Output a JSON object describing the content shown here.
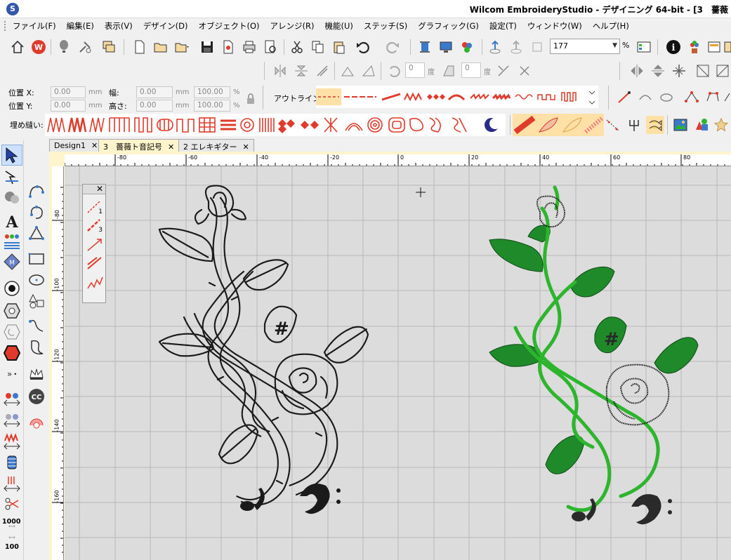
{
  "window": {
    "title": "Wilcom EmbroideryStudio - デザイニング 64-bit - [3　薔薇"
  },
  "menu": {
    "items": [
      "ファイル(F)",
      "編集(E)",
      "表示(V)",
      "デザイン(D)",
      "オブジェクト(O)",
      "アレンジ(R)",
      "機能(U)",
      "ステッチ(S)",
      "グラフィック(G)",
      "設定(T)",
      "ウィンドウ(W)",
      "ヘルプ(H)"
    ]
  },
  "toolbar": {
    "zoom_value": "177",
    "zoom_unit": "%",
    "undo_count_1": "0",
    "undo_count_1_unit": "度",
    "undo_count_2": "0",
    "undo_count_2_unit": "度"
  },
  "properties": {
    "pos_x_label": "位置 X:",
    "pos_y_label": "位置 Y:",
    "pos_x": "0.00",
    "pos_y": "0.00",
    "width_label": "幅:",
    "height_label": "高さ:",
    "width": "0.00",
    "height": "0.00",
    "scale_w": "100.00",
    "scale_h": "100.00",
    "unit_mm": "mm",
    "unit_pct": "%",
    "outline_label": "アウトライン:"
  },
  "fill": {
    "label": "埋め縫い:"
  },
  "tabs": [
    {
      "label": "Design1",
      "active": false
    },
    {
      "label": "3　薔薇ト音記号",
      "active": true
    },
    {
      "label": "2 エレキギター",
      "active": false
    }
  ],
  "ruler": {
    "top_labels": [
      "-80",
      "-60",
      "-40",
      "-20",
      "0",
      "20",
      "40",
      "60",
      "80"
    ],
    "left_labels": [
      "-80",
      "-100",
      "-120",
      "-140",
      "-160"
    ]
  },
  "float_panel": {
    "items": [
      "1",
      "3"
    ]
  },
  "toolbox": {
    "count_1000": "1000",
    "count_100": "100"
  },
  "colors": {
    "stitch_black": "#1a1a1a",
    "stitch_green": "#2db52d",
    "leaf_green": "#1e8a2a",
    "canvas_grey": "#dcdcdc",
    "accent_red": "#e03a2a"
  }
}
